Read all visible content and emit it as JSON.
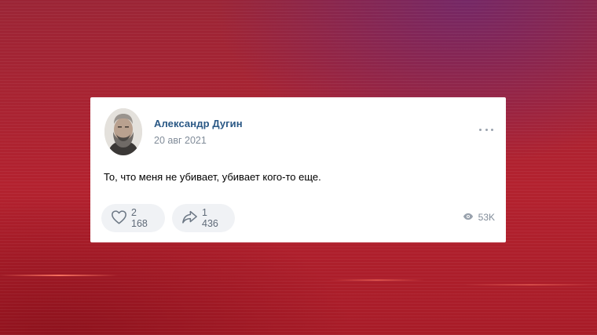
{
  "post": {
    "author": "Александр Дугин",
    "date": "20 авг 2021",
    "text": "То, что меня не убивает, убивает кого-то еще.",
    "likes": "2 168",
    "shares": "1 436",
    "views": "53K"
  },
  "icons": {
    "avatar": "author-photo",
    "more": "more-horizontal-icon",
    "like": "heart-outline-icon",
    "share": "share-arrow-icon",
    "views": "eye-icon"
  },
  "colors": {
    "author_link": "#2a5885",
    "secondary_text": "#818c99",
    "pill_bg": "#f0f2f5",
    "background": "#b3222f"
  }
}
